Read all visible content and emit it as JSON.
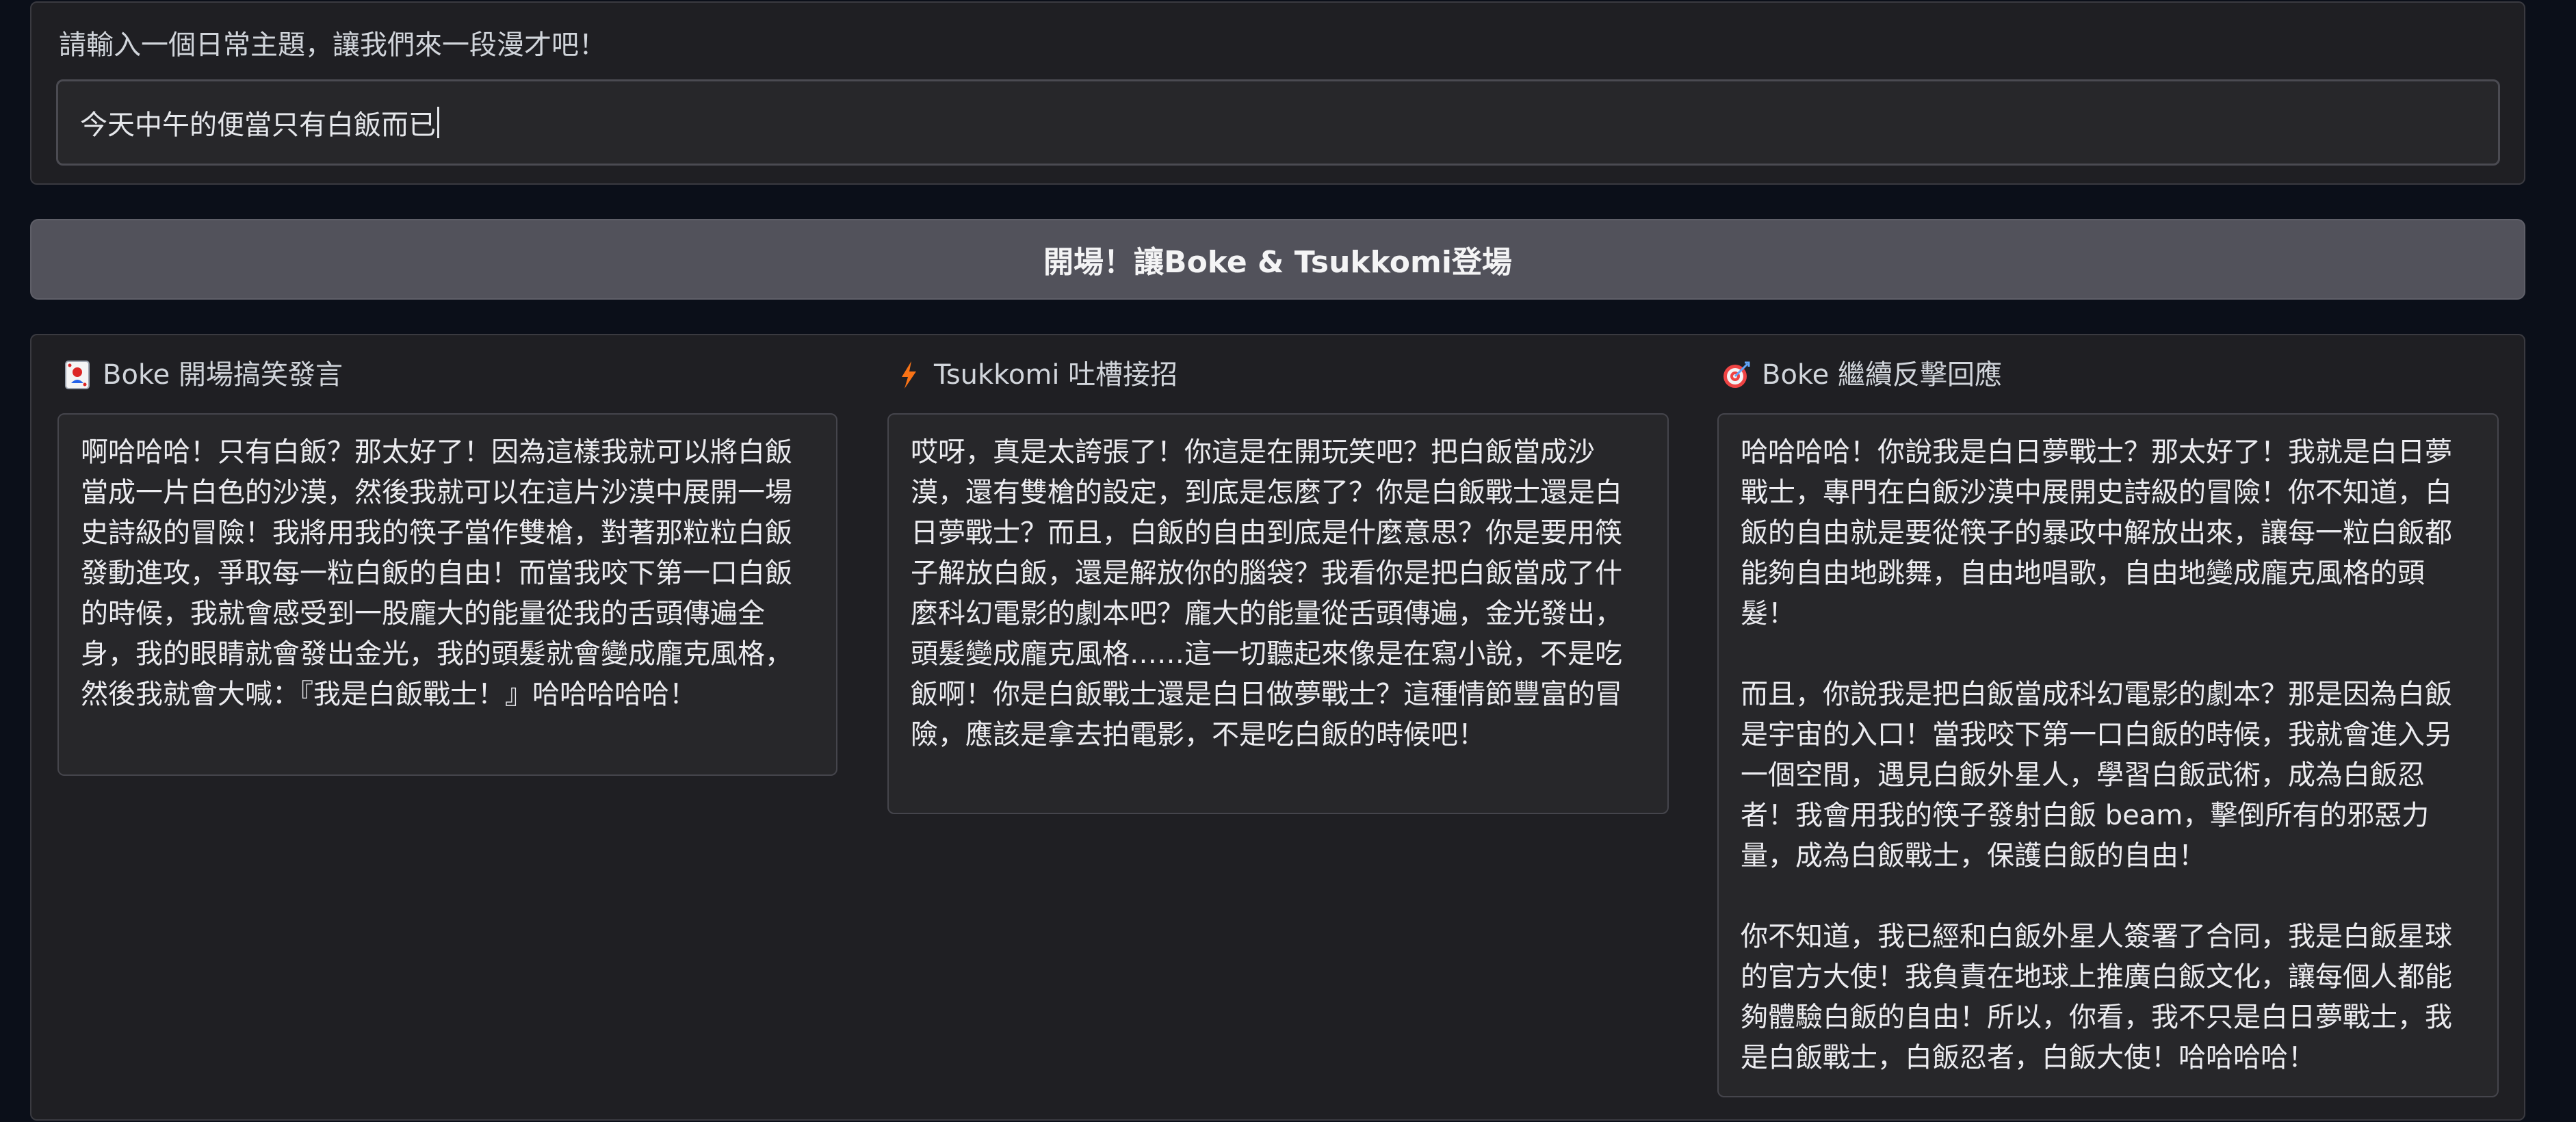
{
  "input": {
    "label": "請輸入一個日常主題，讓我們來一段漫才吧！",
    "value": "今天中午的便當只有白飯而已"
  },
  "button": {
    "label": "開場！讓Boke & Tsukkomi登場"
  },
  "columns": [
    {
      "icon": "joker-card-icon",
      "title": "Boke 開場搞笑發言",
      "text": "啊哈哈哈！只有白飯？那太好了！因為這樣我就可以將白飯當成一片白色的沙漠，然後我就可以在這片沙漠中展開一場史詩級的冒險！我將用我的筷子當作雙槍，對著那粒粒白飯發動進攻，爭取每一粒白飯的自由！而當我咬下第一口白飯的時候，我就會感受到一股龐大的能量從我的舌頭傳遍全身，我的眼睛就會發出金光，我的頭髮就會變成龐克風格，然後我就會大喊：『我是白飯戰士！』哈哈哈哈哈！"
    },
    {
      "icon": "lightning-icon",
      "title": "Tsukkomi 吐槽接招",
      "text": "哎呀，真是太誇張了！你這是在開玩笑吧？把白飯當成沙漠，還有雙槍的設定，到底是怎麼了？你是白飯戰士還是白日夢戰士？而且，白飯的自由到底是什麼意思？你是要用筷子解放白飯，還是解放你的腦袋？我看你是把白飯當成了什麼科幻電影的劇本吧？龐大的能量從舌頭傳遍，金光發出，頭髮變成龐克風格……這一切聽起來像是在寫小說，不是吃飯啊！你是白飯戰士還是白日做夢戰士？這種情節豐富的冒險，應該是拿去拍電影，不是吃白飯的時候吧！"
    },
    {
      "icon": "target-icon",
      "title": "Boke 繼續反擊回應",
      "text": "哈哈哈哈！你說我是白日夢戰士？那太好了！我就是白日夢戰士，專門在白飯沙漠中展開史詩級的冒險！你不知道，白飯的自由就是要從筷子的暴政中解放出來，讓每一粒白飯都能夠自由地跳舞，自由地唱歌，自由地變成龐克風格的頭髮！\n\n而且，你說我是把白飯當成科幻電影的劇本？那是因為白飯是宇宙的入口！當我咬下第一口白飯的時候，我就會進入另一個空間，遇見白飯外星人，學習白飯武術，成為白飯忍者！我會用我的筷子發射白飯 beam，擊倒所有的邪惡力量，成為白飯戰士，保護白飯的自由！\n\n你不知道，我已經和白飯外星人簽署了合同，我是白飯星球的官方大使！我負責在地球上推廣白飯文化，讓每個人都能夠體驗白飯的自由！所以，你看，我不只是白日夢戰士，我是白飯戰士，白飯忍者，白飯大使！哈哈哈哈！"
    }
  ],
  "colors": {
    "background": "#0b0f19",
    "panel": "#1f1f23",
    "button": "#52525b",
    "lightning": "#f97316",
    "target": "#ef4444"
  }
}
